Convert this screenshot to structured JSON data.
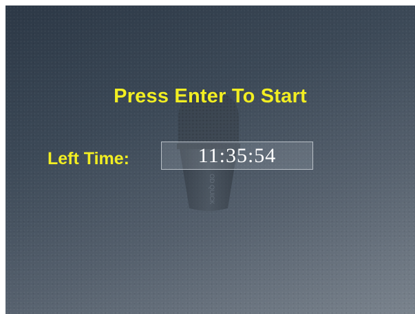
{
  "screen": {
    "prompt": "Press Enter To Start",
    "left_time_label": "Left Time:",
    "left_time_value": "11:35:54"
  },
  "background": {
    "image": "microphone-icon",
    "accent_text_color": "#f2ee22",
    "timer_text_color": "#ffffff"
  }
}
